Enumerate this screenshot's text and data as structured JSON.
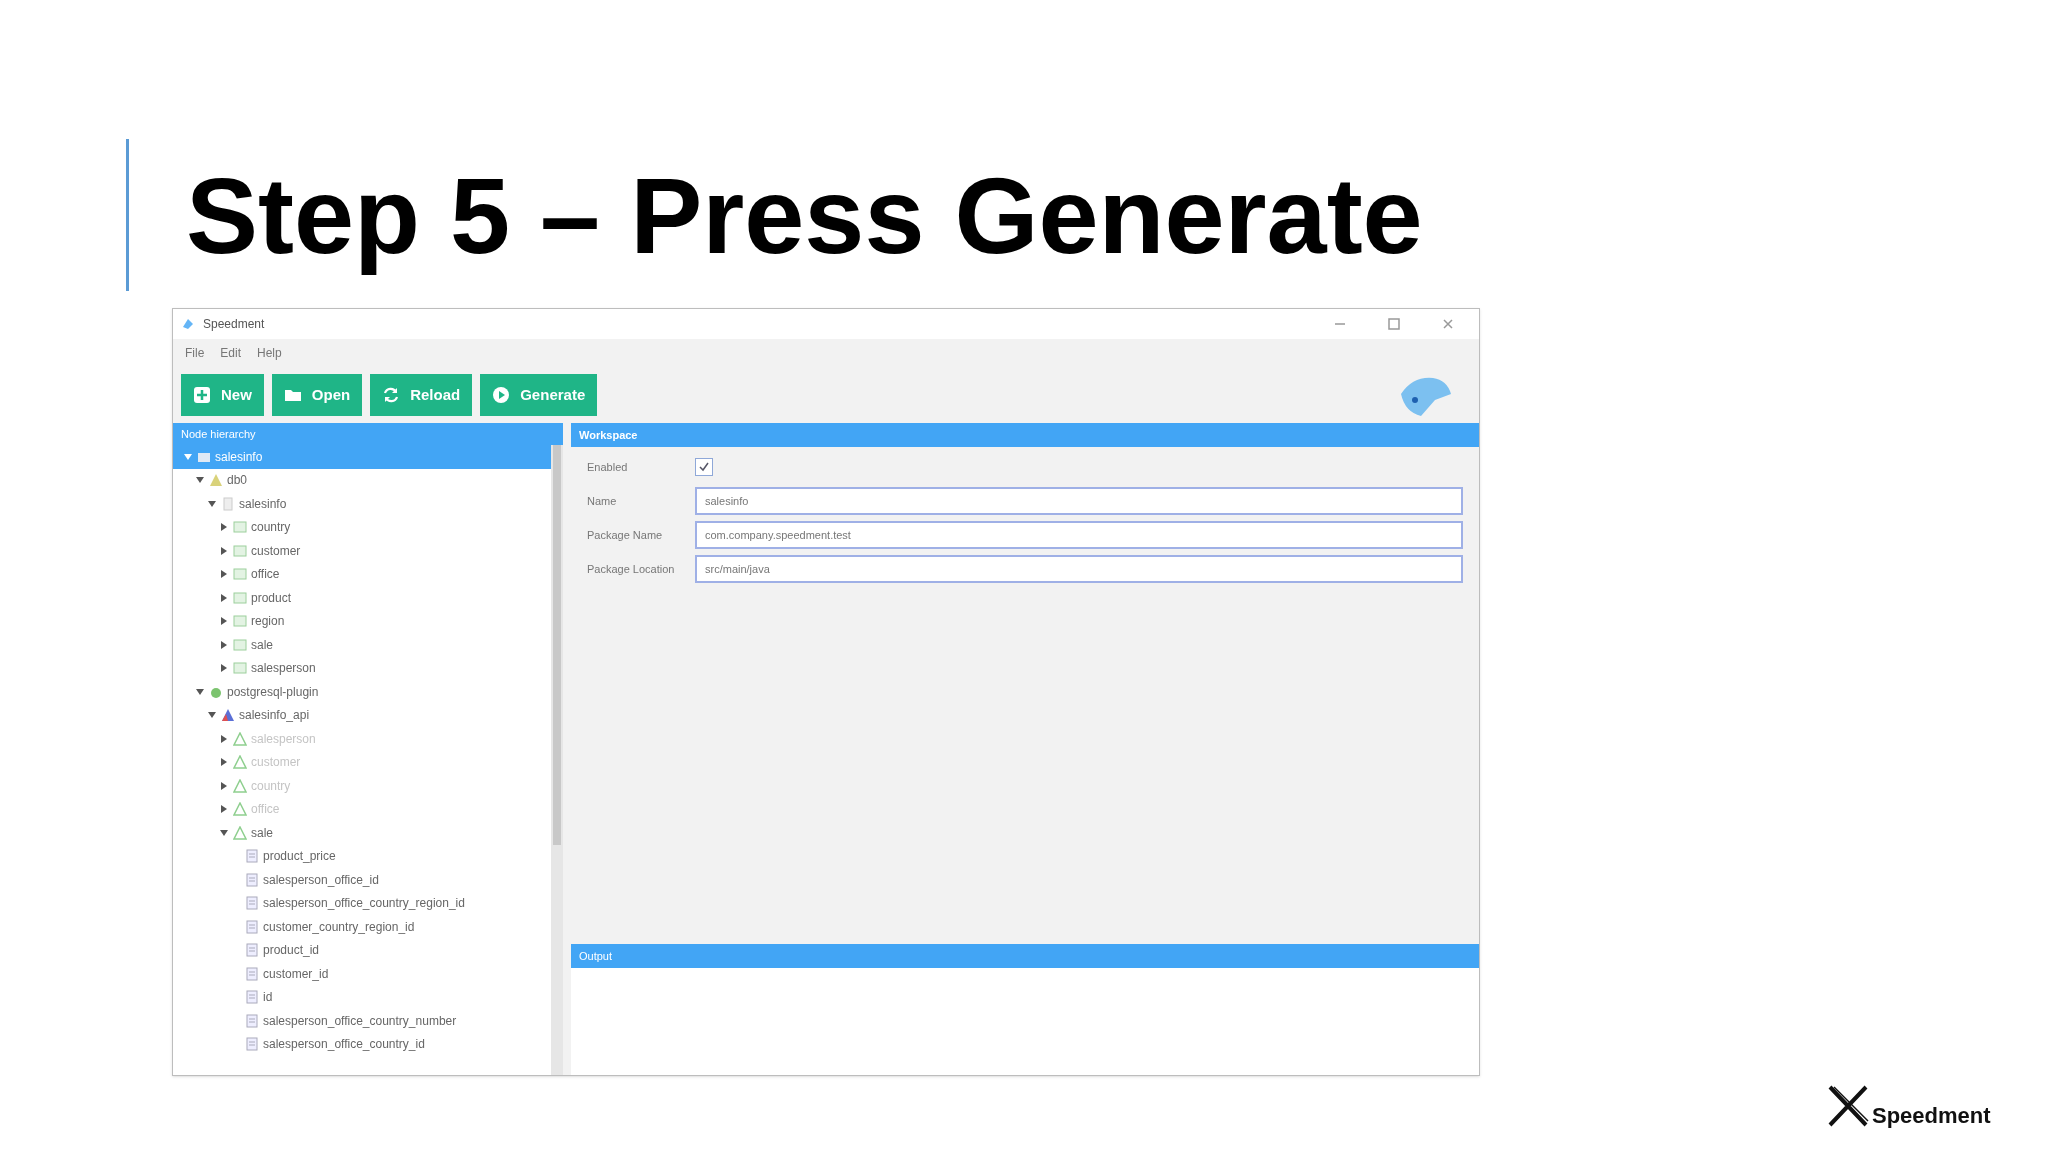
{
  "slide": {
    "title": "Step 5 – Press Generate",
    "footer_logo": "Speedment"
  },
  "window": {
    "title": "Speedment"
  },
  "menu": [
    "File",
    "Edit",
    "Help"
  ],
  "toolbar": [
    {
      "label": "New",
      "kind": "new"
    },
    {
      "label": "Open",
      "kind": "open"
    },
    {
      "label": "Reload",
      "kind": "reload"
    },
    {
      "label": "Generate",
      "kind": "generate"
    }
  ],
  "tree": {
    "title": "Node hierarchy",
    "items": [
      {
        "label": "salesinfo",
        "kind": "project",
        "expanded": true,
        "selected": true,
        "disabled": false,
        "children": [
          {
            "label": "db0",
            "kind": "dbms",
            "expanded": true,
            "selected": false,
            "disabled": false,
            "children": [
              {
                "label": "salesinfo",
                "kind": "schema",
                "expanded": true,
                "selected": false,
                "disabled": false,
                "children": [
                  {
                    "label": "country",
                    "kind": "table",
                    "expanded": false,
                    "selected": false,
                    "disabled": false
                  },
                  {
                    "label": "customer",
                    "kind": "table",
                    "expanded": false,
                    "selected": false,
                    "disabled": false
                  },
                  {
                    "label": "office",
                    "kind": "table",
                    "expanded": false,
                    "selected": false,
                    "disabled": false
                  },
                  {
                    "label": "product",
                    "kind": "table",
                    "expanded": false,
                    "selected": false,
                    "disabled": false
                  },
                  {
                    "label": "region",
                    "kind": "table",
                    "expanded": false,
                    "selected": false,
                    "disabled": false
                  },
                  {
                    "label": "sale",
                    "kind": "table",
                    "expanded": false,
                    "selected": false,
                    "disabled": false
                  },
                  {
                    "label": "salesperson",
                    "kind": "table",
                    "expanded": false,
                    "selected": false,
                    "disabled": false
                  }
                ]
              }
            ]
          },
          {
            "label": "postgresql-plugin",
            "kind": "plugin",
            "expanded": true,
            "selected": false,
            "disabled": false,
            "children": [
              {
                "label": "salesinfo_api",
                "kind": "api",
                "expanded": true,
                "selected": false,
                "disabled": false,
                "children": [
                  {
                    "label": "salesperson",
                    "kind": "entity",
                    "expanded": false,
                    "selected": false,
                    "disabled": true
                  },
                  {
                    "label": "customer",
                    "kind": "entity",
                    "expanded": false,
                    "selected": false,
                    "disabled": true
                  },
                  {
                    "label": "country",
                    "kind": "entity",
                    "expanded": false,
                    "selected": false,
                    "disabled": true
                  },
                  {
                    "label": "office",
                    "kind": "entity",
                    "expanded": false,
                    "selected": false,
                    "disabled": true
                  },
                  {
                    "label": "sale",
                    "kind": "entity",
                    "expanded": true,
                    "selected": false,
                    "disabled": false,
                    "children": [
                      {
                        "label": "product_price",
                        "kind": "column",
                        "selected": false,
                        "disabled": false
                      },
                      {
                        "label": "salesperson_office_id",
                        "kind": "column",
                        "selected": false,
                        "disabled": false
                      },
                      {
                        "label": "salesperson_office_country_region_id",
                        "kind": "column",
                        "selected": false,
                        "disabled": false
                      },
                      {
                        "label": "customer_country_region_id",
                        "kind": "column",
                        "selected": false,
                        "disabled": false
                      },
                      {
                        "label": "product_id",
                        "kind": "column",
                        "selected": false,
                        "disabled": false
                      },
                      {
                        "label": "customer_id",
                        "kind": "column",
                        "selected": false,
                        "disabled": false
                      },
                      {
                        "label": "id",
                        "kind": "column",
                        "selected": false,
                        "disabled": false
                      },
                      {
                        "label": "salesperson_office_country_number",
                        "kind": "column",
                        "selected": false,
                        "disabled": false
                      },
                      {
                        "label": "salesperson_office_country_id",
                        "kind": "column",
                        "selected": false,
                        "disabled": false
                      }
                    ]
                  }
                ]
              }
            ]
          }
        ]
      }
    ]
  },
  "workspace": {
    "title": "Workspace",
    "fields": [
      {
        "label": "Enabled",
        "kind": "checkbox",
        "checked": true
      },
      {
        "label": "Name",
        "kind": "text",
        "value": "salesinfo"
      },
      {
        "label": "Package Name",
        "kind": "text",
        "value": "com.company.speedment.test"
      },
      {
        "label": "Package Location",
        "kind": "text",
        "value": "src/main/java"
      }
    ]
  },
  "output": {
    "title": "Output"
  }
}
